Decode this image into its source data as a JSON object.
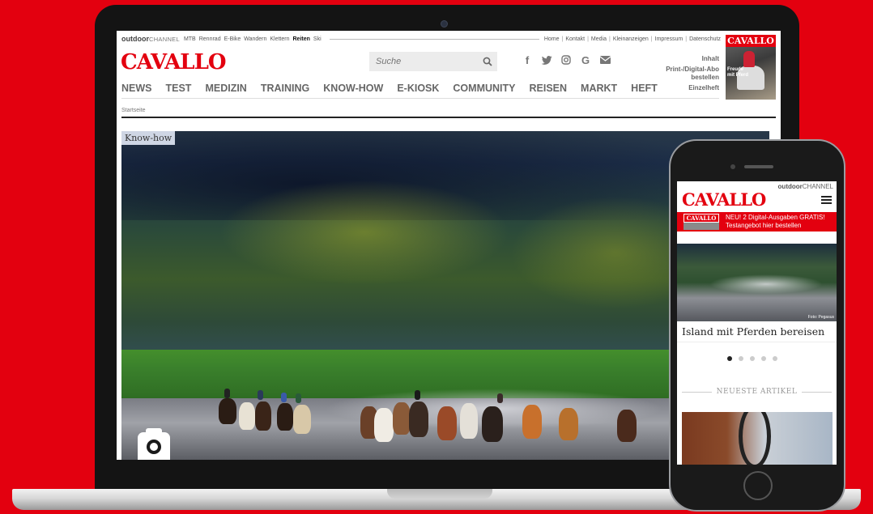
{
  "desktop": {
    "topbar": {
      "brand_bold": "outdoor",
      "brand_light": "CHANNEL",
      "categories": [
        {
          "label": "MTB",
          "active": false
        },
        {
          "label": "Rennrad",
          "active": false
        },
        {
          "label": "E-Bike",
          "active": false
        },
        {
          "label": "Wandern",
          "active": false
        },
        {
          "label": "Klettern",
          "active": false
        },
        {
          "label": "Reiten",
          "active": true
        },
        {
          "label": "Ski",
          "active": false
        }
      ],
      "utility_links": [
        "Home",
        "Kontakt",
        "Media",
        "Kleinanzeigen",
        "Impressum",
        "Datenschutz"
      ],
      "separator": "|"
    },
    "logo": "CAVALLO",
    "search": {
      "placeholder": "Suche"
    },
    "social_icons": [
      "facebook-icon",
      "twitter-icon",
      "instagram-icon",
      "google-icon",
      "email-icon"
    ],
    "side_links": {
      "inhalt": "Inhalt",
      "print_abo": "Print-/Digital-Abo bestellen",
      "einzelheft": "Einzelheft"
    },
    "magazine_cover": {
      "title": "CAVALLO",
      "headline": "Freude mit Pferd"
    },
    "nav": [
      "NEWS",
      "TEST",
      "MEDIZIN",
      "TRAINING",
      "KNOW-HOW",
      "E-KIOSK",
      "COMMUNITY",
      "REISEN",
      "MARKT",
      "HEFT"
    ],
    "breadcrumb": "Startseite",
    "hero": {
      "tag": "Know-how"
    }
  },
  "mobile": {
    "brand_bold": "outdoor",
    "brand_light": "CHANNEL",
    "logo": "CAVALLO",
    "promo": {
      "cover_title": "CAVALLO",
      "line1": "NEU! 2 Digital-Ausgaben GRATIS!",
      "line2": "Testangebot hier bestellen"
    },
    "hero_credit": "Foto: Pegasus",
    "article_title": "Island mit Pferden bereisen",
    "carousel": {
      "count": 5,
      "active": 1
    },
    "section_title": "NEUESTE ARTIKEL"
  },
  "colors": {
    "brand_red": "#e3000f",
    "background": "#e3000f"
  }
}
